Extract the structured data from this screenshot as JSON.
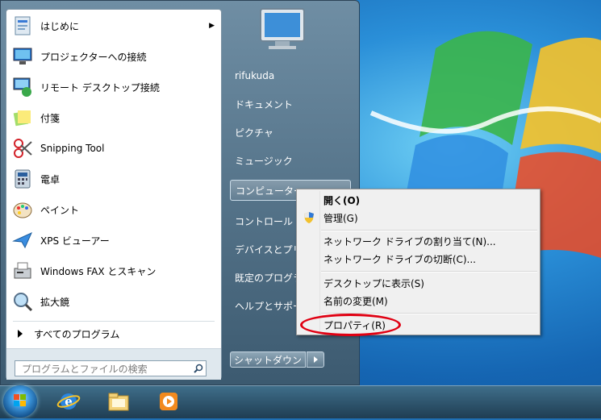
{
  "start_menu": {
    "programs": [
      {
        "label": "はじめに",
        "icon": "getting-started-icon",
        "has_submenu": true
      },
      {
        "label": "プロジェクターへの接続",
        "icon": "projector-icon",
        "has_submenu": false
      },
      {
        "label": "リモート デスクトップ接続",
        "icon": "remote-desktop-icon",
        "has_submenu": false
      },
      {
        "label": "付箋",
        "icon": "sticky-notes-icon",
        "has_submenu": false
      },
      {
        "label": "Snipping Tool",
        "icon": "scissors-icon",
        "has_submenu": false
      },
      {
        "label": "電卓",
        "icon": "calculator-icon",
        "has_submenu": false
      },
      {
        "label": "ペイント",
        "icon": "paint-palette-icon",
        "has_submenu": false
      },
      {
        "label": "XPS ビューアー",
        "icon": "xps-viewer-icon",
        "has_submenu": false
      },
      {
        "label": "Windows FAX とスキャン",
        "icon": "fax-icon",
        "has_submenu": false
      },
      {
        "label": "拡大鏡",
        "icon": "magnifier-icon",
        "has_submenu": false
      }
    ],
    "all_programs_label": "すべてのプログラム",
    "search_placeholder": "プログラムとファイルの検索",
    "right_items": [
      {
        "label": "rifukuda"
      },
      {
        "label": "ドキュメント"
      },
      {
        "label": "ピクチャ"
      },
      {
        "label": "ミュージック"
      },
      {
        "label": "コンピューター",
        "highlighted": true
      },
      {
        "label": "コントロール パネル"
      },
      {
        "label": "デバイスとプリンター"
      },
      {
        "label": "既定のプログラム"
      },
      {
        "label": "ヘルプとサポート"
      }
    ],
    "shutdown_label": "シャットダウン"
  },
  "context_menu": {
    "items": [
      {
        "label": "開く(O)",
        "bold": true
      },
      {
        "label": "管理(G)",
        "icon": "shield-icon"
      },
      {
        "label": "ネットワーク ドライブの割り当て(N)..."
      },
      {
        "label": "ネットワーク ドライブの切断(C)..."
      },
      {
        "label": "デスクトップに表示(S)"
      },
      {
        "label": "名前の変更(M)"
      },
      {
        "label": "プロパティ(R)",
        "circled": true
      }
    ]
  },
  "taskbar": {
    "items": [
      "start-orb-icon",
      "internet-explorer-icon",
      "file-explorer-icon",
      "media-player-icon"
    ]
  },
  "colors": {
    "annotation_circle": "#e00012",
    "start_menu_bg": "#4f6f86",
    "context_bg": "#f0f0f0"
  }
}
